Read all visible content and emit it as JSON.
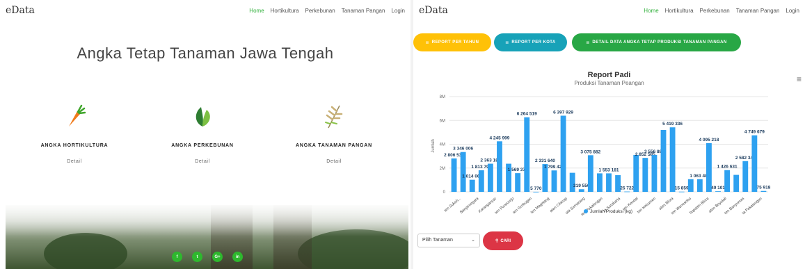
{
  "left": {
    "brand": "eData",
    "nav": [
      "Home",
      "Hortikultura",
      "Perkebunan",
      "Tanaman Pangan",
      "Login"
    ],
    "hero_title": "Angka Tetap Tanaman Jawa Tengah",
    "features": [
      {
        "title": "ANGKA HORTIKULTURA",
        "link": "Detail",
        "icon": "carrot-icon"
      },
      {
        "title": "ANGKA PERKEBUNAN",
        "link": "Detail",
        "icon": "leaf-icon"
      },
      {
        "title": "ANGKA TANAMAN PANGAN",
        "link": "Detail",
        "icon": "wheat-icon"
      }
    ],
    "socials": [
      "f",
      "t",
      "G+",
      "in"
    ]
  },
  "right": {
    "brand": "eData",
    "nav": [
      "Home",
      "Hortikultura",
      "Perkebunan",
      "Tanaman Pangan",
      "Login"
    ],
    "buttons": [
      "REPORT PER TAHUN",
      "REPORT PER KOTA",
      "DETAIL DATA ANGKA TETAP PRODUKSI TANAMAN PANGAN"
    ],
    "select_value": "Pilih Tanaman",
    "search_label": "CARI"
  },
  "colors": {
    "accent": "#2eaf39",
    "bar": "#2ea1f0",
    "yellow": "#ffc107",
    "cyan": "#17a2b8",
    "green": "#28a745",
    "red": "#dc3545"
  },
  "chart_data": {
    "type": "bar",
    "title": "Report Padi",
    "subtitle": "Produksi Tanaman Peangan",
    "ylabel": "Jumlah",
    "ylim": [
      0,
      8000000
    ],
    "yticks": [
      "0",
      "2M",
      "4M",
      "6M",
      "8M"
    ],
    "legend": "Jumlah Produksi (kg)",
    "categories": [
      "ten Sukoh...",
      "Banjarnegara",
      "Karanganyar",
      "ten Purworejo",
      "ten Grobogan",
      "ten Magelang",
      "aten Cilacap",
      "ota Semarang",
      "ten Pekalongan",
      "ta Surakarta",
      "ten Kendal",
      "ten Kebumen",
      "aten Blora",
      "ten Wonosobo",
      "bupaten Blora",
      "aten Boyolali",
      "ten Banyumas",
      "ta Pekalongan"
    ],
    "values": [
      2806535,
      3346006,
      1014069,
      1813799,
      2363186,
      4245999,
      2363186,
      1569378,
      6264519,
      5770,
      2331640,
      1799423,
      6397929,
      1600000,
      219550,
      3075882,
      1553181,
      1553181,
      1400000,
      25722,
      3100000,
      2852585,
      3100000,
      5200000,
      5419336,
      15859,
      1063480,
      1063480,
      4095218,
      49101,
      1826631,
      1426631,
      2582347,
      4749679,
      75918
    ],
    "value_labels": [
      "2 806 535",
      "3 346 006",
      "1 014 069",
      "1 813 799",
      "2 363 186",
      "4 245 999",
      "",
      "1 569 378",
      "6 264 519",
      "5 770",
      "2 331 640",
      "1 799 423",
      "6 397 929",
      "",
      "219 550",
      "3 075 882",
      "",
      "1 553 181",
      "",
      "25 722",
      "",
      "2 852 585",
      "3 556 883",
      "",
      "5 419 336",
      "15 859",
      "",
      "1 063 480",
      "4 095 218",
      "49 101",
      "1 426 631",
      "",
      "2 582 347",
      "4 749 679",
      "75 918"
    ]
  }
}
